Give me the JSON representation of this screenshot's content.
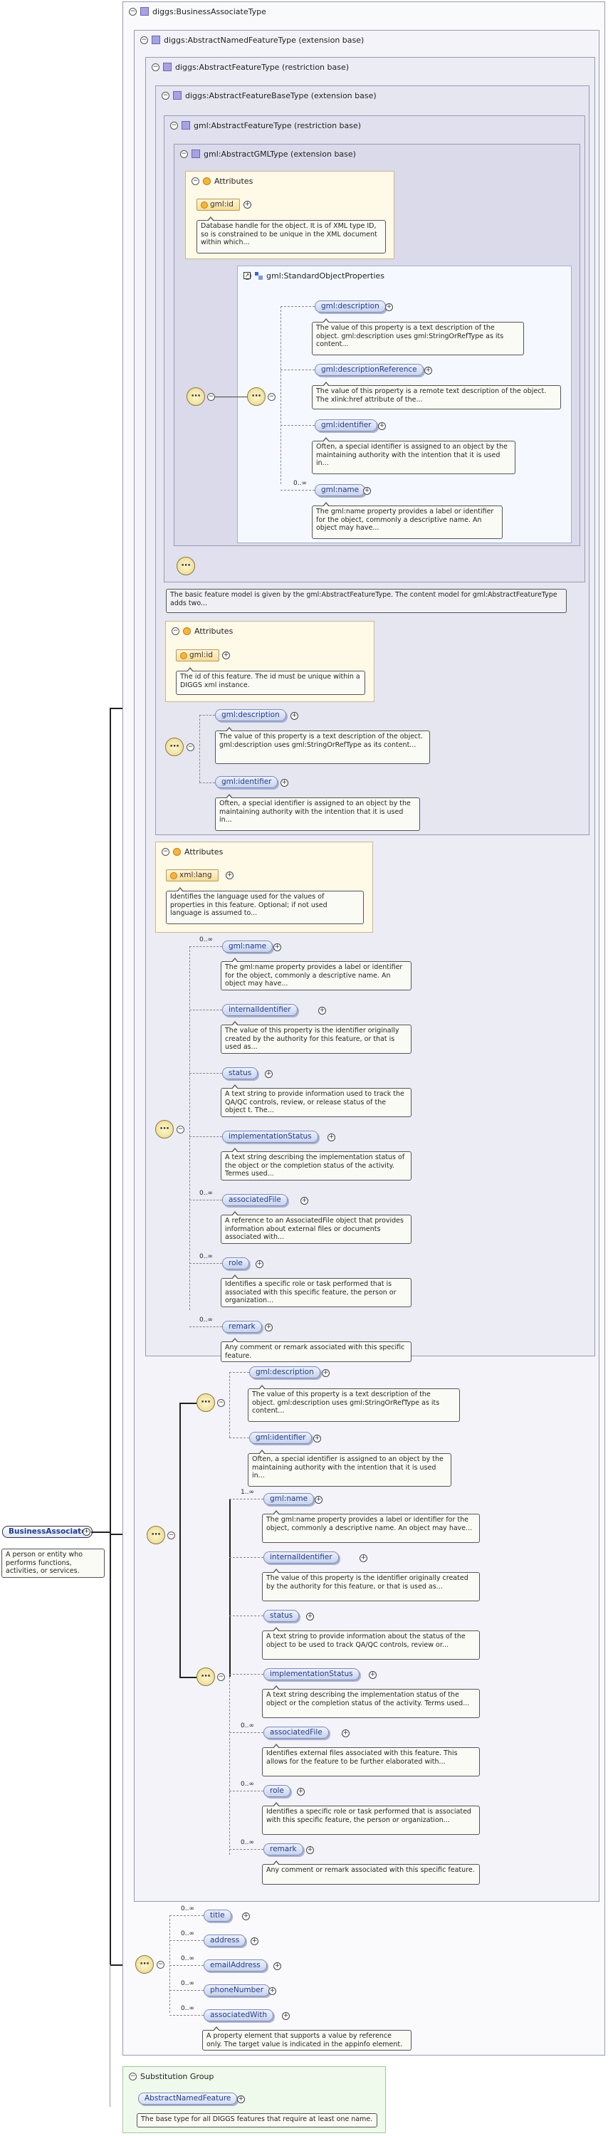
{
  "root_type": {
    "title": "diggs:BusinessAssociateType"
  },
  "named_feature_type": {
    "title": "diggs:AbstractNamedFeatureType (extension base)"
  },
  "abstract_feature_type": {
    "title": "diggs:AbstractFeatureType (restriction base)"
  },
  "abstract_feature_base_type": {
    "title": "diggs:AbstractFeatureBaseType (extension base)"
  },
  "gml_feature_type": {
    "title": "gml:AbstractFeatureType (restriction base)"
  },
  "gml_gml_type": {
    "title": "gml:AbstractGMLType (extension base)",
    "attributes_label": "Attributes",
    "id_attr": "gml:id",
    "id_desc": "Database handle for the object. It is of XML type ID, so is constrained to be unique in the XML document within which...",
    "group_title": "gml:StandardObjectProperties",
    "elements": [
      {
        "name": "gml:description",
        "desc": "The value of this property is a text description of the object. gml:description uses gml:StringOrRefType as its content..."
      },
      {
        "name": "gml:descriptionReference",
        "desc": "The value of this property is a remote text description of the object. The xlink:href attribute of the..."
      },
      {
        "name": "gml:identifier",
        "desc": "Often, a special identifier is assigned to an object by the maintaining authority with the intention that it is used in..."
      },
      {
        "name": "gml:name",
        "card": "0..∞",
        "desc": "The gml:name property provides a label or identifier for the object, commonly a descriptive name. An object may have..."
      }
    ]
  },
  "feature_type_desc": "The basic feature model is given by the gml:AbstractFeatureType. The content model for gml:AbstractFeatureType adds two...",
  "feature_base": {
    "attributes_label": "Attributes",
    "id_attr": "gml:id",
    "id_desc": "The id of this feature. The id must be unique within a DIGGS xml instance.",
    "elements": [
      {
        "name": "gml:description",
        "desc": "The value of this property is a text description of the object. gml:description uses gml:StringOrRefType as its content..."
      },
      {
        "name": "gml:identifier",
        "desc": "Often, a special identifier is assigned to an object by the maintaining authority with the intention that it is used in..."
      }
    ]
  },
  "abstract_feature": {
    "attributes_label": "Attributes",
    "lang_attr": "xml:lang",
    "lang_desc": "Identifies the language used for the values of properties in this feature. Optional; if not used language is assumed to...",
    "elements": [
      {
        "name": "gml:name",
        "card": "0..∞",
        "desc": "The gml:name property provides a label or identifier for the object, commonly a descriptive name. An object may have..."
      },
      {
        "name": "internalIdentifier",
        "card": "",
        "desc": "The value of this property is the identifier originally created by the authority for this feature, or that is used as..."
      },
      {
        "name": "status",
        "card": "",
        "desc": "A text string to provide information used to track the QA/QC controls, review, or release status of the object t. The..."
      },
      {
        "name": "implementationStatus",
        "card": "",
        "desc": "A text string describing the implementation status of the object or the completion status of the activity. Termes used..."
      },
      {
        "name": "associatedFile",
        "card": "0..∞",
        "desc": "A reference to an AssociatedFile object that provides information about external files or documents associated with..."
      },
      {
        "name": "role",
        "card": "0..∞",
        "desc": "Identifies a specific role or task performed that is associated with this specific feature, the person or organization..."
      },
      {
        "name": "remark",
        "card": "0..∞",
        "desc": "Any comment or remark associated with this specific feature."
      }
    ]
  },
  "named_feature": {
    "first_elements": [
      {
        "name": "gml:description",
        "desc": "The value of this property is a text description of the object. gml:description uses gml:StringOrRefType as its content..."
      },
      {
        "name": "gml:identifier",
        "desc": "Often, a special identifier is assigned to an object by the maintaining authority with the intention that it is used in..."
      }
    ],
    "elements": [
      {
        "name": "gml:name",
        "card": "1..∞",
        "desc": "The gml:name property provides a label or identifier for the object, commonly a descriptive name. An object may have..."
      },
      {
        "name": "internalIdentifier",
        "card": "",
        "desc": "The value of this property is the identifier originally created by the authority for this feature, or that is used as..."
      },
      {
        "name": "status",
        "card": "",
        "desc": "A text string to provide information about the status of the object to be used to track QA/QC controls, review or..."
      },
      {
        "name": "implementationStatus",
        "card": "",
        "desc": "A text string describing the implementation status of the object or the completion status of the activity. Terms used..."
      },
      {
        "name": "associatedFile",
        "card": "0..∞",
        "desc": "Identifies external files associated with this feature. This allows for the feature to be further elaborated with..."
      },
      {
        "name": "role",
        "card": "0..∞",
        "desc": "Identifies a specific role or task performed that is associated with this specific feature, the person or organization..."
      },
      {
        "name": "remark",
        "card": "0..∞",
        "desc": "Any comment or remark associated with this specific feature."
      }
    ]
  },
  "business_associate": {
    "elements": [
      {
        "name": "title",
        "card": "0..∞"
      },
      {
        "name": "address",
        "card": "0..∞"
      },
      {
        "name": "emailAddress",
        "card": "0..∞"
      },
      {
        "name": "phoneNumber",
        "card": "0..∞"
      },
      {
        "name": "associatedWith",
        "card": "0..∞",
        "desc": "A property element that supports a value by reference only. The target value is indicated in the appinfo element."
      }
    ]
  },
  "main_element": {
    "name": "BusinessAssociate",
    "desc": "A person or entity who performs functions, activities, or services."
  },
  "substitution": {
    "title": "Substitution Group",
    "element": "AbstractNamedFeature",
    "desc": "The base type for all DIGGS features that require at least one name."
  }
}
